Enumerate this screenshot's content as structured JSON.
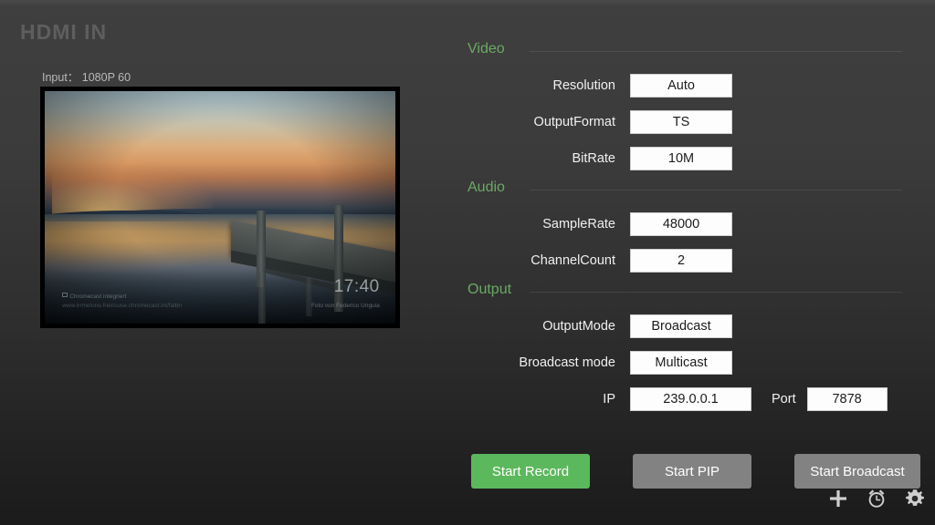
{
  "header": {
    "title": "HDMI IN",
    "input_status": "Input： 1080P  60"
  },
  "preview": {
    "overlay_time": "17:40",
    "overlay_credit": "Foto von Federico Unguia",
    "cc_line1": "Chromecast integriert",
    "cc_line2": "www.irrmelone.fnet/suse.chromecast.int/falbn"
  },
  "sections": [
    {
      "title": "Video"
    },
    {
      "title": "Audio"
    },
    {
      "title": "Output"
    }
  ],
  "video": {
    "fields": [
      {
        "label": "Resolution",
        "value": "Auto"
      },
      {
        "label": "OutputFormat",
        "value": "TS"
      },
      {
        "label": "BitRate",
        "value": "10M"
      }
    ]
  },
  "audio": {
    "fields": [
      {
        "label": "SampleRate",
        "value": "48000"
      },
      {
        "label": "ChannelCount",
        "value": "2"
      }
    ]
  },
  "output": {
    "fields": [
      {
        "label": "OutputMode",
        "value": "Broadcast"
      },
      {
        "label": "Broadcast mode",
        "value": "Multicast"
      }
    ],
    "ip_label": "IP",
    "ip_value": "239.0.0.1",
    "port_label": "Port",
    "port_value": "7878"
  },
  "buttons": {
    "record": "Start Record",
    "pip": "Start PIP",
    "broadcast": "Start Broadcast"
  },
  "icons": {
    "add": "plus-icon",
    "alarm": "alarm-clock-icon",
    "settings": "gear-icon"
  },
  "colors": {
    "accent_green": "#6aaa64",
    "button_green": "#5cb85c",
    "button_gray": "#828282",
    "field_bg": "#fdfdfd",
    "background_top": "#3f3f3f",
    "background_bottom": "#1b1b1b"
  }
}
